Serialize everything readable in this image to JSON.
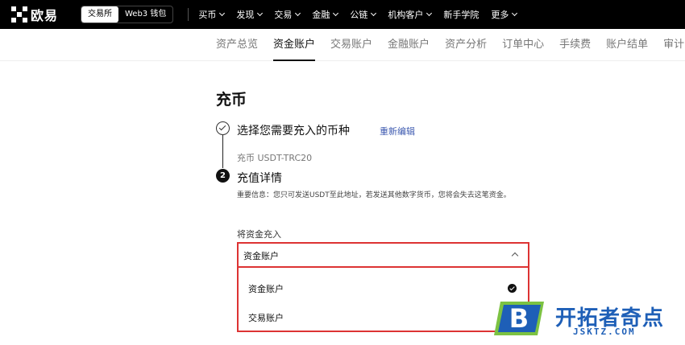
{
  "header": {
    "logo_text": "欧易",
    "mode_toggle": [
      "交易所",
      "Web3 钱包"
    ],
    "nav": [
      {
        "label": "买币",
        "has_menu": true
      },
      {
        "label": "发现",
        "has_menu": true
      },
      {
        "label": "交易",
        "has_menu": true
      },
      {
        "label": "金融",
        "has_menu": true
      },
      {
        "label": "公链",
        "has_menu": true
      },
      {
        "label": "机构客户",
        "has_menu": true
      },
      {
        "label": "新手学院",
        "has_menu": false
      },
      {
        "label": "更多",
        "has_menu": true
      }
    ]
  },
  "subnav": {
    "tabs": [
      "资产总览",
      "资金账户",
      "交易账户",
      "金融账户",
      "资产分析",
      "订单中心",
      "手续费",
      "账户结单",
      "审计"
    ],
    "active_index": 1
  },
  "page": {
    "title": "充币",
    "step1": {
      "title": "选择您需要充入的币种",
      "edit_link": "重新编辑",
      "summary": "充币 USDT-TRC20"
    },
    "step2": {
      "number": "2",
      "title": "充值详情",
      "notice": "重要信息：您只可发送USDT至此地址，若发送其他数字货币，您将会失去这笔资金。"
    },
    "field_label": "将资金充入",
    "select": {
      "value": "资金账户",
      "options": [
        {
          "label": "资金账户",
          "selected": true
        },
        {
          "label": "交易账户",
          "selected": false
        }
      ]
    }
  },
  "watermark": {
    "text": "开拓者奇点",
    "url": "JSKTZ.COM",
    "letter": "B"
  },
  "colors": {
    "accent_link": "#3d5ab0",
    "highlight_border": "#dd3333",
    "watermark_blue": "#1e5fb7",
    "watermark_green": "#7cc242"
  }
}
